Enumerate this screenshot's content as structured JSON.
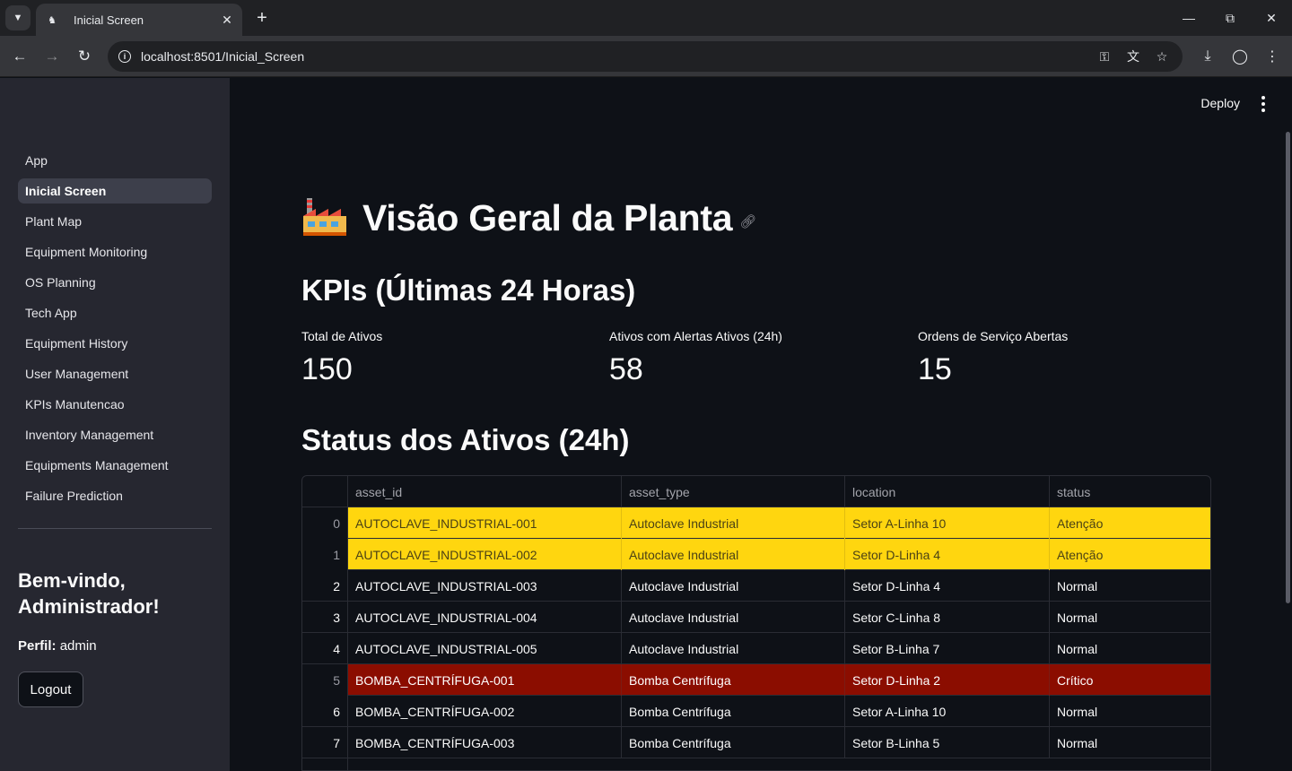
{
  "browser": {
    "tab_title": "Inicial Screen",
    "url": "localhost:8501/Inicial_Screen"
  },
  "sidebar": {
    "items": [
      {
        "label": "App",
        "active": false
      },
      {
        "label": "Inicial Screen",
        "active": true
      },
      {
        "label": "Plant Map",
        "active": false
      },
      {
        "label": "Equipment Monitoring",
        "active": false
      },
      {
        "label": "OS Planning",
        "active": false
      },
      {
        "label": "Tech App",
        "active": false
      },
      {
        "label": "Equipment History",
        "active": false
      },
      {
        "label": "User Management",
        "active": false
      },
      {
        "label": "KPIs Manutencao",
        "active": false
      },
      {
        "label": "Inventory Management",
        "active": false
      },
      {
        "label": "Equipments Management",
        "active": false
      },
      {
        "label": "Failure Prediction",
        "active": false
      }
    ],
    "welcome": "Bem-vindo, Administrador!",
    "profile_label": "Perfil:",
    "profile_value": "admin",
    "logout_label": "Logout"
  },
  "header": {
    "deploy_label": "Deploy"
  },
  "main": {
    "title": "Visão Geral da Planta",
    "kpi_heading": "KPIs (Últimas 24 Horas)",
    "metrics": [
      {
        "label": "Total de Ativos",
        "value": "150"
      },
      {
        "label": "Ativos com Alertas Ativos (24h)",
        "value": "58"
      },
      {
        "label": "Ordens de Serviço Abertas",
        "value": "15"
      }
    ],
    "status_heading": "Status dos Ativos (24h)",
    "table": {
      "columns": [
        "asset_id",
        "asset_type",
        "location",
        "status"
      ],
      "rows": [
        {
          "idx": "0",
          "asset_id": "AUTOCLAVE_INDUSTRIAL-001",
          "asset_type": "Autoclave Industrial",
          "location": "Setor A-Linha 10",
          "status": "Atenção",
          "level": "warn"
        },
        {
          "idx": "1",
          "asset_id": "AUTOCLAVE_INDUSTRIAL-002",
          "asset_type": "Autoclave Industrial",
          "location": "Setor D-Linha 4",
          "status": "Atenção",
          "level": "warn"
        },
        {
          "idx": "2",
          "asset_id": "AUTOCLAVE_INDUSTRIAL-003",
          "asset_type": "Autoclave Industrial",
          "location": "Setor D-Linha 4",
          "status": "Normal",
          "level": "norm"
        },
        {
          "idx": "3",
          "asset_id": "AUTOCLAVE_INDUSTRIAL-004",
          "asset_type": "Autoclave Industrial",
          "location": "Setor C-Linha 8",
          "status": "Normal",
          "level": "norm"
        },
        {
          "idx": "4",
          "asset_id": "AUTOCLAVE_INDUSTRIAL-005",
          "asset_type": "Autoclave Industrial",
          "location": "Setor B-Linha 7",
          "status": "Normal",
          "level": "norm"
        },
        {
          "idx": "5",
          "asset_id": "BOMBA_CENTRÍFUGA-001",
          "asset_type": "Bomba Centrífuga",
          "location": "Setor D-Linha 2",
          "status": "Crítico",
          "level": "crit"
        },
        {
          "idx": "6",
          "asset_id": "BOMBA_CENTRÍFUGA-002",
          "asset_type": "Bomba Centrífuga",
          "location": "Setor A-Linha 10",
          "status": "Normal",
          "level": "norm"
        },
        {
          "idx": "7",
          "asset_id": "BOMBA_CENTRÍFUGA-003",
          "asset_type": "Bomba Centrífuga",
          "location": "Setor B-Linha 5",
          "status": "Normal",
          "level": "norm"
        }
      ]
    }
  },
  "colors": {
    "warn": "#ffd60f",
    "critical": "#8b0d00",
    "background": "#0e1117",
    "sidebar": "#262730"
  }
}
